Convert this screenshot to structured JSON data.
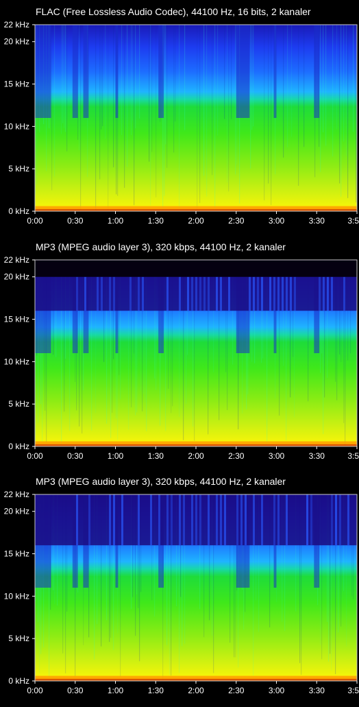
{
  "chart_data": [
    {
      "type": "heatmap",
      "title": "FLAC (Free Lossless Audio Codec), 44100 Hz, 16 bits, 2 kanaler",
      "y_ticks": [
        "22 kHz",
        "20 kHz",
        "15 kHz",
        "10 kHz",
        "5 kHz",
        "0 kHz"
      ],
      "y_values": [
        22,
        20,
        15,
        10,
        5,
        0
      ],
      "x_ticks": [
        "0:00",
        "0:30",
        "1:00",
        "1:30",
        "2:00",
        "2:30",
        "3:00",
        "3:30",
        "3:5"
      ],
      "x_values": [
        0,
        30,
        60,
        90,
        120,
        150,
        180,
        210,
        240
      ],
      "xlim": [
        0,
        240
      ],
      "ylim": [
        0,
        22
      ],
      "cutoff_khz": 22,
      "colormap": [
        "#000000",
        "#1a0a8f",
        "#1f3dff",
        "#22b8ff",
        "#1de41d",
        "#7ce80e",
        "#e8f00a",
        "#ffb000",
        "#c01000"
      ]
    },
    {
      "type": "heatmap",
      "title": "MP3 (MPEG audio layer 3), 320 kbps, 44100 Hz, 2 kanaler",
      "y_ticks": [
        "22 kHz",
        "20 kHz",
        "15 kHz",
        "10 kHz",
        "5 kHz",
        "0 kHz"
      ],
      "y_values": [
        22,
        20,
        15,
        10,
        5,
        0
      ],
      "x_ticks": [
        "0:00",
        "0:30",
        "1:00",
        "1:30",
        "2:00",
        "2:30",
        "3:00",
        "3:30",
        "3:5"
      ],
      "x_values": [
        0,
        30,
        60,
        90,
        120,
        150,
        180,
        210,
        240
      ],
      "xlim": [
        0,
        240
      ],
      "ylim": [
        0,
        22
      ],
      "cutoff_khz": 20,
      "shelf_khz": 16
    },
    {
      "type": "heatmap",
      "title": "MP3 (MPEG audio layer 3), 320 kbps, 44100 Hz, 2 kanaler",
      "y_ticks": [
        "22 kHz",
        "20 kHz",
        "15 kHz",
        "10 kHz",
        "5 kHz",
        "0 kHz"
      ],
      "y_values": [
        22,
        20,
        15,
        10,
        5,
        0
      ],
      "x_ticks": [
        "0:00",
        "0:30",
        "1:00",
        "1:30",
        "2:00",
        "2:30",
        "3:00",
        "3:30",
        "3:5"
      ],
      "x_values": [
        0,
        30,
        60,
        90,
        120,
        150,
        180,
        210,
        240
      ],
      "xlim": [
        0,
        240
      ],
      "ylim": [
        0,
        22
      ],
      "cutoff_khz": 22,
      "shelf_khz": 16
    }
  ]
}
